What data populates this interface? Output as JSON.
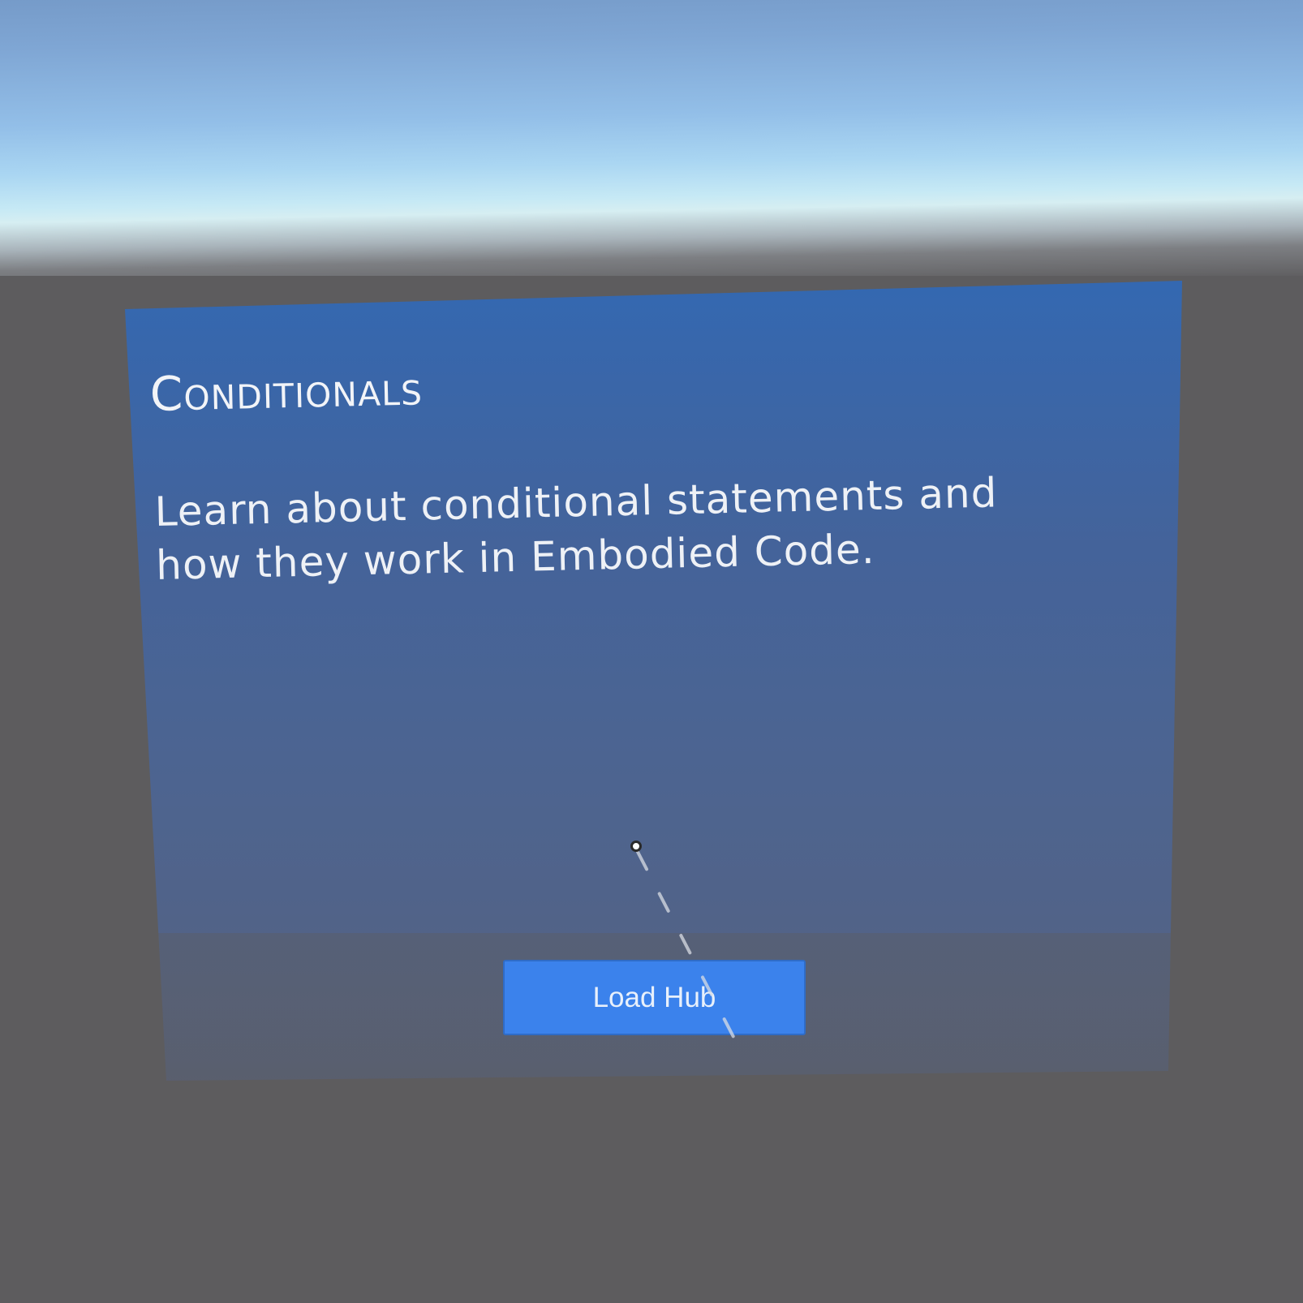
{
  "panel": {
    "title": "Conditionals",
    "description": "Learn about conditional statements and how they work in Embodied Code.",
    "button_label": "Load Hub"
  },
  "colors": {
    "panel_top": "#2f6fbd",
    "panel_bottom": "#5d5e66",
    "button": "#3b82ec",
    "ground": "#5d5c5e",
    "sky_top": "#6f93c1",
    "horizon": "#d6eef2"
  },
  "icons": {
    "pointer": "vr-pointer-cursor-icon",
    "ray": "laser-pointer-ray"
  }
}
